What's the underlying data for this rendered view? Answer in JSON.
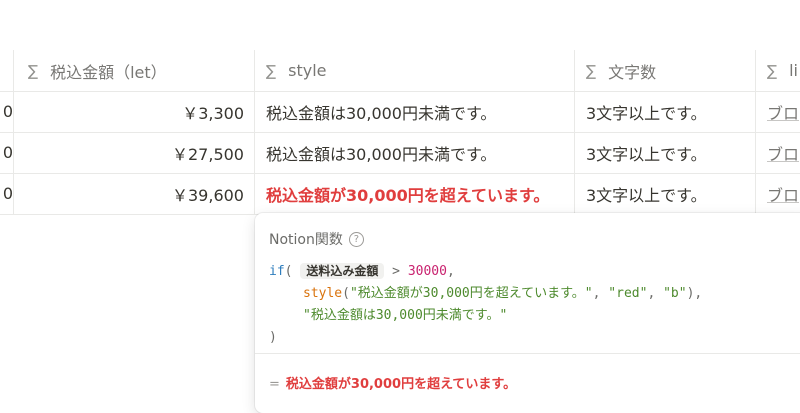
{
  "table": {
    "headers": {
      "c0": "",
      "c1": "税込金額（let）",
      "c2": "style",
      "c3": "文字数",
      "c4": "li"
    },
    "sigma": "∑",
    "rows": [
      {
        "c0": "0",
        "c1": "￥3,300",
        "c2": "税込金額は30,000円未満です。",
        "c3": "3文字以上です。",
        "c4": "ブロ"
      },
      {
        "c0": "0",
        "c1": "￥27,500",
        "c2": "税込金額は30,000円未満です。",
        "c3": "3文字以上です。",
        "c4": "ブロ"
      },
      {
        "c0": "0",
        "c1": "￥39,600",
        "c2": "税込金額が30,000円を超えています。",
        "c3": "3文字以上です。",
        "c4": "ブロ"
      }
    ]
  },
  "popup": {
    "title": "Notion関数",
    "help": "?",
    "code": {
      "if": "if",
      "paren_open": "(",
      "prop": "送料込み金額",
      "gt": ">",
      "num": "30000",
      "comma": ",",
      "style_fn": "style",
      "style_args_1": "\"税込金額が30,000円を超えています。\"",
      "style_args_2": "\"red\"",
      "style_args_3": "\"b\"",
      "else_str": "\"税込金額は30,000円未満です。\"",
      "paren_close": ")"
    },
    "result_eq": "=",
    "result": "税込金額が30,000円を超えています。"
  }
}
